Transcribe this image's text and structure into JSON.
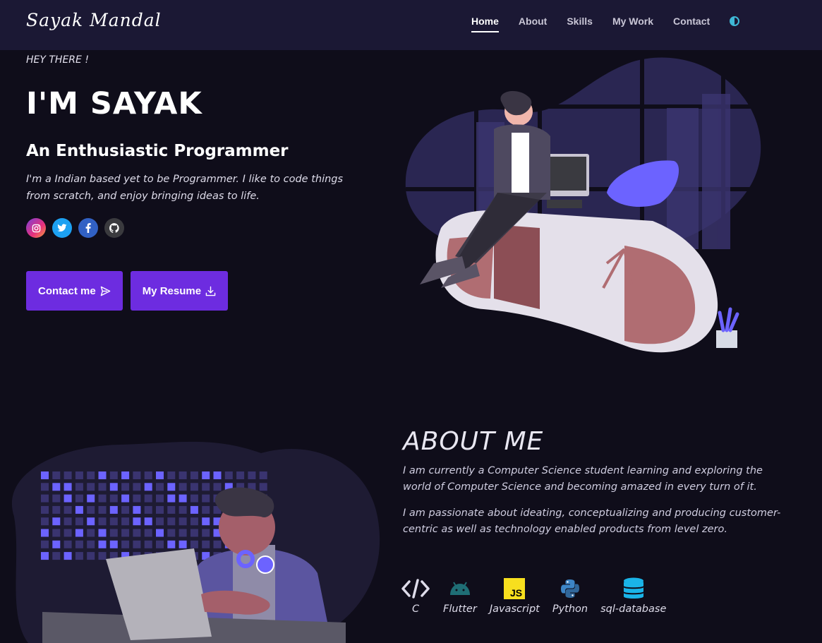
{
  "navbar": {
    "brand": "Sayak Mandal",
    "links": [
      "Home",
      "About",
      "Skills",
      "My Work",
      "Contact"
    ],
    "active": "Home",
    "theme_icon": "half-circle-icon"
  },
  "hero": {
    "greeting": "HEY THERE !",
    "name": "I'M SAYAK",
    "subtitle": "An Enthusiastic Programmer",
    "description": "I'm a Indian based yet to be Programmer. I like to code things from scratch, and enjoy bringing ideas to life.",
    "socials": [
      "instagram-icon",
      "twitter-icon",
      "facebook-icon",
      "github-icon"
    ],
    "buttons": {
      "contact": "Contact me",
      "resume": "My Resume"
    }
  },
  "about": {
    "title": "ABOUT ME",
    "paragraph1": "I am currently a Computer Science student learning and exploring the world of Computer Science and becoming amazed in every turn of it.",
    "paragraph2": "I am passionate about ideating, conceptualizing and producing customer-centric as well as technology enabled products from level zero.",
    "skills": [
      {
        "label": "C",
        "icon": "code-icon"
      },
      {
        "label": "Flutter",
        "icon": "android-icon"
      },
      {
        "label": "Javascript",
        "icon": "javascript-icon"
      },
      {
        "label": "Python",
        "icon": "python-icon"
      },
      {
        "label": "sql-database",
        "icon": "database-icon"
      }
    ]
  },
  "colors": {
    "background": "#0f0d1a",
    "navbar": "#1b1834",
    "accent": "#6d2ce0",
    "illustration_purple": "#6c63ff"
  }
}
